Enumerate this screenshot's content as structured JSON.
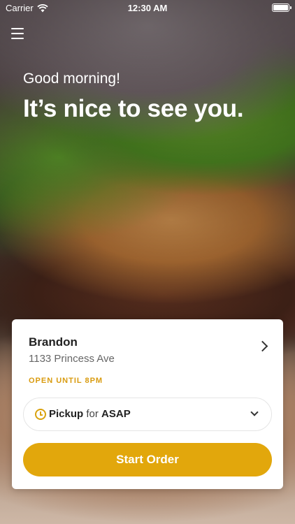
{
  "status_bar": {
    "carrier": "Carrier",
    "time": "12:30 AM"
  },
  "hero": {
    "greeting": "Good morning!",
    "headline": "It’s nice to see you."
  },
  "store": {
    "name": "Brandon",
    "address": "1133 Princess Ave",
    "open_status": "OPEN UNTIL 8PM"
  },
  "order": {
    "mode": "Pickup",
    "connector": "for",
    "time": "ASAP",
    "start_label": "Start Order"
  },
  "colors": {
    "accent": "#e2a70c",
    "open_status": "#d99b0f"
  },
  "icons": [
    "wifi-icon",
    "battery-icon",
    "menu-icon",
    "chevron-right-icon",
    "clock-icon",
    "chevron-down-icon"
  ]
}
